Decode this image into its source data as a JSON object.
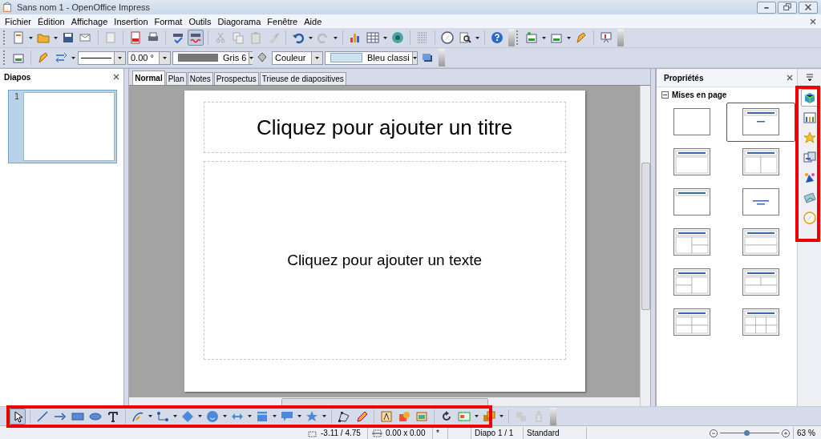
{
  "window": {
    "title": "Sans nom 1 - OpenOffice Impress"
  },
  "menu": [
    {
      "label": "Fichier"
    },
    {
      "label": "Édition"
    },
    {
      "label": "Affichage"
    },
    {
      "label": "Insertion"
    },
    {
      "label": "Format"
    },
    {
      "label": "Outils"
    },
    {
      "label": "Diagorama"
    },
    {
      "label": "Fenêtre"
    },
    {
      "label": "Aide"
    }
  ],
  "line_toolbar": {
    "angle": "0.00 °",
    "line_color": "Gris 6",
    "fill_type": "Couleur",
    "fill_color": "Bleu classi"
  },
  "slides_panel": {
    "title": "Diapos",
    "slides": [
      {
        "number": "1",
        "selected": true
      }
    ]
  },
  "view_tabs": [
    {
      "label": "Normal",
      "selected": true
    },
    {
      "label": "Plan",
      "selected": false
    },
    {
      "label": "Notes",
      "selected": false
    },
    {
      "label": "Prospectus",
      "selected": false
    },
    {
      "label": "Trieuse de diapositives",
      "selected": false
    }
  ],
  "slide": {
    "title_placeholder": "Cliquez pour ajouter un titre",
    "content_placeholder": "Cliquez pour ajouter un texte"
  },
  "properties_panel": {
    "title": "Propriétés",
    "section": "Mises en page",
    "layouts": [
      {
        "kind": "blank",
        "selected": false
      },
      {
        "kind": "title-subtitle",
        "selected": true
      },
      {
        "kind": "title-content",
        "selected": false
      },
      {
        "kind": "title-two-columns",
        "selected": false
      },
      {
        "kind": "title-only",
        "selected": false
      },
      {
        "kind": "centered-text",
        "selected": false
      },
      {
        "kind": "title-content-right-split",
        "selected": false
      },
      {
        "kind": "title-top-bottom",
        "selected": false
      },
      {
        "kind": "title-left-split-content",
        "selected": false
      },
      {
        "kind": "title-two-rows",
        "selected": false
      },
      {
        "kind": "title-four",
        "selected": false
      },
      {
        "kind": "title-six",
        "selected": false
      }
    ]
  },
  "sidebar_tabs": [
    {
      "selected": true
    },
    {
      "selected": false
    },
    {
      "selected": false
    },
    {
      "selected": false
    },
    {
      "selected": false
    },
    {
      "selected": false
    },
    {
      "selected": false
    }
  ],
  "status_bar": {
    "position": "-3.11 / 4.75",
    "size": "0.00 x 0.00",
    "modified": "*",
    "slide": "Diapo 1 / 1",
    "master": "Standard",
    "zoom": {
      "level": 0.45
    },
    "zoom_reading": "63 %"
  }
}
